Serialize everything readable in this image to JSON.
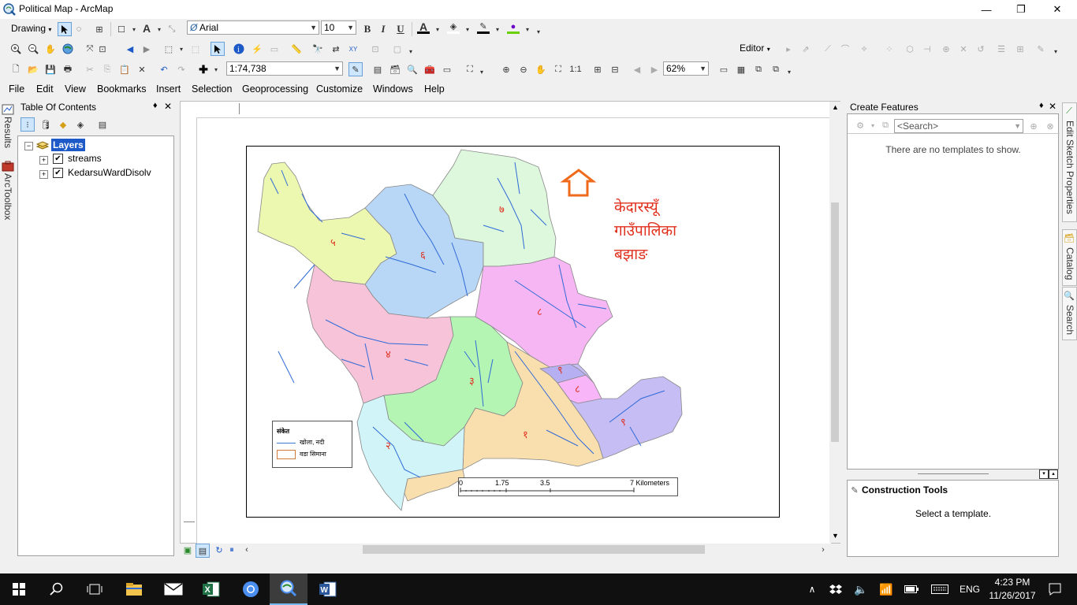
{
  "window": {
    "title": "Political Map - ArcMap",
    "minimize": "—",
    "restore": "❐",
    "close": "✕"
  },
  "drawing_toolbar": {
    "drawing_label": "Drawing",
    "font_name": "Arial",
    "font_size": "10",
    "bold": "B",
    "italic": "I",
    "underline": "U",
    "font_color_glyph": "A",
    "text_tool_glyph": "A"
  },
  "editor_toolbar": {
    "editor_label": "Editor"
  },
  "standard_toolbar": {
    "scale": "1:74,738"
  },
  "layout_toolbar": {
    "zoom_percent": "62%"
  },
  "menubar": {
    "items": [
      "File",
      "Edit",
      "View",
      "Bookmarks",
      "Insert",
      "Selection",
      "Geoprocessing",
      "Customize",
      "Windows",
      "Help"
    ]
  },
  "toc": {
    "title": "Table Of Contents",
    "pin": "♦",
    "close": "✕",
    "group_label": "Layers",
    "layers": [
      {
        "name": "streams",
        "checked": true
      },
      {
        "name": "KedarsuWardDisolv",
        "checked": true
      }
    ]
  },
  "left_side_tabs": {
    "results": "Results",
    "arctoolbox": "ArcToolbox"
  },
  "create_features": {
    "title": "Create Features",
    "search_placeholder": "<Search>",
    "empty_message": "There are no templates to show.",
    "construction_title": "Construction Tools",
    "construction_message": "Select a template."
  },
  "right_side_tabs": {
    "edit_sketch": "Edit Sketch Properties",
    "catalog": "Catalog",
    "search": "Search"
  },
  "map": {
    "title_lines": [
      "केदारस्यूँ",
      "गाउँपालिका",
      "बझाङ"
    ],
    "north_arrow": "north-arrow",
    "colors": {
      "accent_red": "#e0301e",
      "north_arrow": "#f06a1c"
    },
    "wards": [
      {
        "label": "१",
        "color": "#fadfae"
      },
      {
        "label": "२",
        "color": "#d0f4f8"
      },
      {
        "label": "३",
        "color": "#b4f5b4"
      },
      {
        "label": "४",
        "color": "#f7c3d8"
      },
      {
        "label": "५",
        "color": "#ecf8b0"
      },
      {
        "label": "६",
        "color": "#b8d6f6"
      },
      {
        "label": "७",
        "color": "#ddf8dc"
      },
      {
        "label": "८",
        "color": "#f5b6f3"
      },
      {
        "label": "८",
        "color": "#f8b6f8"
      },
      {
        "label": "९",
        "color": "#c5bdf4"
      },
      {
        "label": "९",
        "color": "#b6b0f2"
      }
    ],
    "legend": {
      "title": "संकेत",
      "items": [
        {
          "label": "खोला, नदी",
          "symbol": "line",
          "color": "#3a7bd5"
        },
        {
          "label": "वडा सिमाना",
          "symbol": "box",
          "color": "#d27a3a"
        }
      ]
    },
    "scalebar": {
      "ticks": [
        "0",
        "1.75",
        "3.5",
        "7 Kilometers"
      ]
    }
  },
  "taskbar": {
    "apps": [
      "windows-start",
      "search",
      "task-view",
      "file-explorer",
      "mail",
      "excel",
      "chrome",
      "arcmap",
      "word"
    ],
    "language": "ENG",
    "time": "4:23 PM",
    "date": "11/26/2017"
  }
}
